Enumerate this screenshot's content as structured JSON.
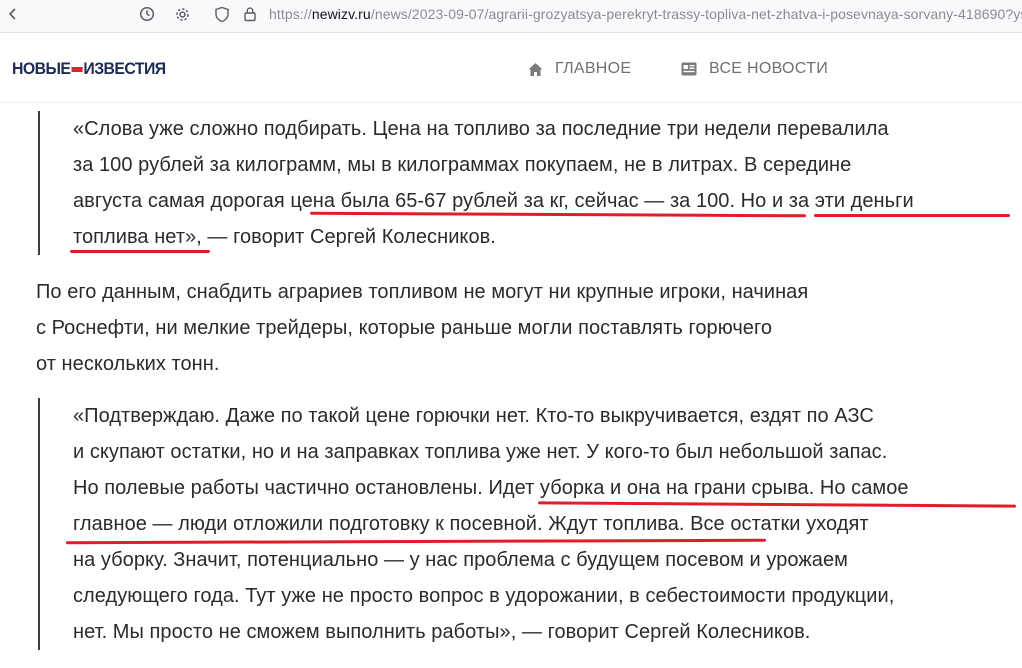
{
  "browser": {
    "url_prefix": "https://",
    "url_domain": "newizv.ru",
    "url_path": "/news/2023-09-07/agrarii-grozyatsya-perekryt-trassy-topliva-net-zhatva-i-posevnaya-sorvany-418690?ys",
    "icons": [
      "history-icon",
      "settings-icon",
      "shield-icon",
      "lock-icon"
    ]
  },
  "header": {
    "logo_left": "НОВЫЕ",
    "logo_right": "ИЗВЕСТИЯ",
    "nav": [
      {
        "label": "ГЛАВНОЕ",
        "icon": "home-icon"
      },
      {
        "label": "ВСЕ НОВОСТИ",
        "icon": "news-icon"
      }
    ]
  },
  "article": {
    "quote1": [
      "«Слова уже сложно подбирать. Цена на топливо за последние три недели перевалила",
      "за 100 рублей за килограмм, мы в килограммах покупаем, не в литрах. В середине",
      "августа самая дорогая цена была 65-67 рублей за кг, сейчас — за 100. Но и за эти деньги",
      "топлива нет», — говорит Сергей Колесников."
    ],
    "paragraph": [
      "По его данным, снабдить аграриев топливом не могут ни крупные игроки, начиная",
      "с Роснефти, ни мелкие трейдеры, которые раньше могли поставлять горючего",
      "от нескольких тонн."
    ],
    "quote2": [
      "«Подтверждаю. Даже по такой цене горючки нет. Кто-то выкручивается, ездят по АЗС",
      "и скупают остатки, но и на заправках топлива уже нет. У кого-то был небольшой запас.",
      "Но полевые работы частично остановлены. Идет уборка и она на грани срыва. Но самое",
      "главное — люди отложили подготовку к посевной. Ждут топлива. Все остатки уходят",
      "на уборку. Значит, потенциально — у нас проблема с будущем посевом и урожаем",
      "следующего года. Тут уже не просто вопрос в удорожании, в себестоимости продукции,",
      "нет. Мы просто не сможем выполнить работы», — говорит Сергей Колесников."
    ]
  },
  "colors": {
    "accent_underline": "#e21d2a",
    "quote_border": "#3d3d3d",
    "text": "#2b2b2b",
    "logo_blue": "#1d2b55",
    "logo_red": "#e0222e"
  }
}
